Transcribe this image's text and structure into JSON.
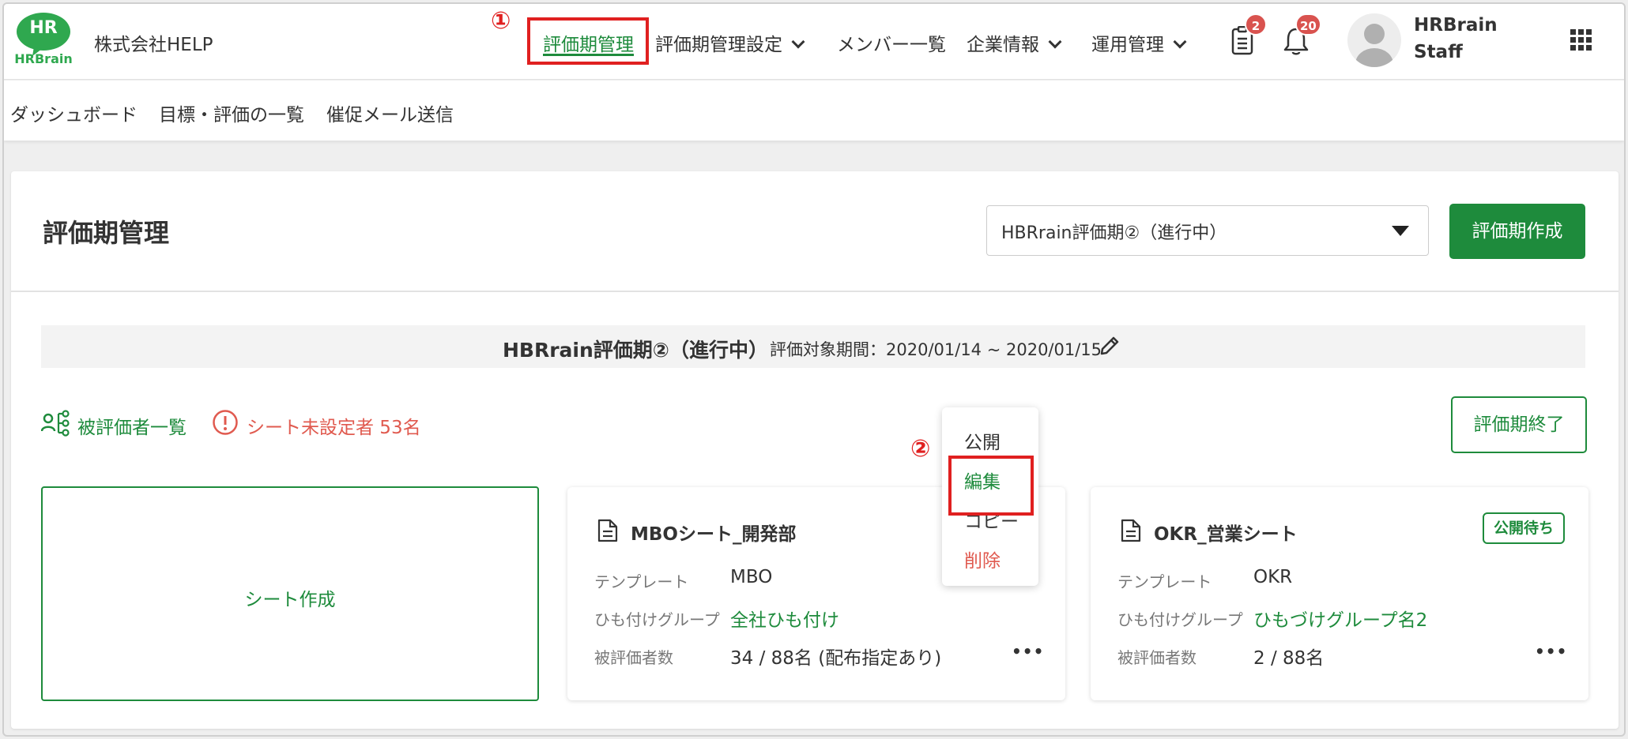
{
  "header": {
    "logo_text_top": "HR",
    "logo_text_bottom": "HRBrain",
    "company": "株式会社HELP",
    "nav": {
      "eval_mgmt": "評価期管理",
      "eval_settings": "評価期管理設定",
      "members": "メンバー一覧",
      "company_info": "企業情報",
      "operations": "運用管理"
    },
    "doc_badge": "2",
    "bell_badge": "20",
    "user_line1": "HRBrain",
    "user_line2": "Staff"
  },
  "annotations": {
    "step1": "①",
    "step2": "②"
  },
  "subnav": {
    "dashboard": "ダッシュボード",
    "goals_list": "目標・評価の一覧",
    "reminder": "催促メール送信"
  },
  "page": {
    "title": "評価期管理",
    "period_select": "HBRrain評価期②（進行中）",
    "create_button": "評価期作成",
    "period_name": "HBRrain評価期②（進行中）",
    "period_range": "評価対象期間：2020/01/14 ~ 2020/01/15",
    "evaluatee_link": "被評価者一覧",
    "unassigned_warning": "シート未設定者 53名",
    "end_button": "評価期終了",
    "create_sheet": "シート作成"
  },
  "sheets": [
    {
      "title": "MBOシート_開発部",
      "template_label": "テンプレート",
      "template": "MBO",
      "group_label": "ひも付けグループ",
      "group": "全社ひも付け",
      "count_label": "被評価者数",
      "count": "34 / 88名 (配布指定あり)",
      "more": "•••"
    },
    {
      "title": "OKR_営業シート",
      "status": "公開待ち",
      "template_label": "テンプレート",
      "template": "OKR",
      "group_label": "ひも付けグループ",
      "group": "ひもづけグループ名2",
      "count_label": "被評価者数",
      "count": "2 / 88名",
      "more": "•••"
    }
  ],
  "context_menu": {
    "publish": "公開",
    "edit": "編集",
    "copy": "コピー",
    "delete": "削除"
  },
  "colors": {
    "accent": "#1e8b3c",
    "danger": "#e05a4f",
    "annotation": "#e02020"
  }
}
